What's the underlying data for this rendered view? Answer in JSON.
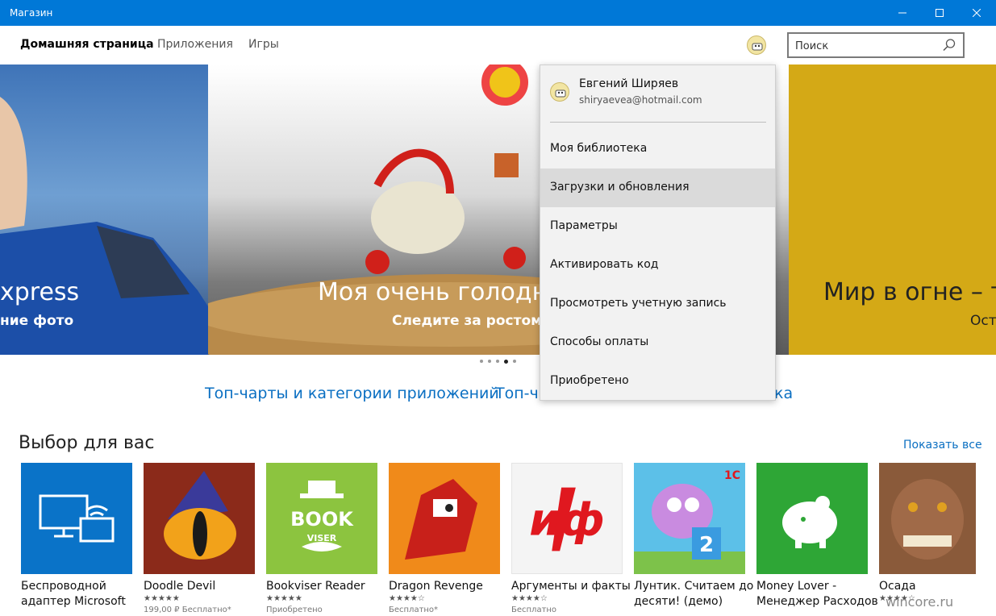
{
  "window": {
    "title": "Магазин",
    "controls": [
      "minimize-icon",
      "maximize-icon",
      "close-icon"
    ]
  },
  "nav": {
    "tabs": [
      "Домашняя страница",
      "Приложения",
      "Игры"
    ],
    "active_tab": "Домашняя страница",
    "search_placeholder": "Поиск"
  },
  "hero": {
    "slides": [
      {
        "title": "xpress",
        "subtitle": "ние фото"
      },
      {
        "title": "Моя очень голодна",
        "subtitle": "Следите за ростом п"
      },
      {
        "title": "Мир в огне – т",
        "subtitle": "Ост"
      }
    ],
    "dots_count": 5,
    "active_dot": 4
  },
  "links": [
    "Топ-чарты и категории приложений",
    "Топ-ч",
    "ка"
  ],
  "section": {
    "title": "Выбор для вас",
    "show_all": "Показать все"
  },
  "apps": [
    {
      "name1": "Беспроводной",
      "name2": "адаптер Microsoft",
      "stars": "",
      "price": "",
      "color": "#0a73c8"
    },
    {
      "name1": "Doodle Devil",
      "name2": "",
      "stars": "★★★★★",
      "price": "199,00 ₽ Бесплатно*",
      "color": "#8b2a1a"
    },
    {
      "name1": "Bookviser Reader",
      "name2": "",
      "stars": "★★★★★",
      "price": "Приобретено",
      "color": "#8cc43f"
    },
    {
      "name1": "Dragon Revenge",
      "name2": "",
      "stars": "★★★★☆",
      "price": "Бесплатно*",
      "color": "#e0541a"
    },
    {
      "name1": "Аргументы и факты",
      "name2": "",
      "stars": "★★★★☆",
      "price": "Бесплатно",
      "color": "#f4f4f4"
    },
    {
      "name1": "Лунтик. Считаем до",
      "name2": "десяти! (демо)",
      "stars": "",
      "price": "",
      "color": "#5cc0e8"
    },
    {
      "name1": "Money Lover -",
      "name2": "Менеджер Расходов",
      "stars": "",
      "price": "",
      "color": "#2ea636"
    },
    {
      "name1": "Осада",
      "name2": "",
      "stars": "★★★★☆",
      "price": "",
      "color": "#6b4a3a"
    }
  ],
  "account_menu": {
    "user_name": "Евгений Ширяев",
    "email": "shiryaevea@hotmail.com",
    "items": [
      "Моя библиотека",
      "Загрузки и обновления",
      "Параметры",
      "Активировать код",
      "Просмотреть учетную запись",
      "Способы оплаты",
      "Приобретено"
    ],
    "highlighted": "Загрузки и обновления"
  },
  "watermark": "wincore.ru",
  "colors": {
    "accent": "#0078d7",
    "link": "#0a6fc2",
    "menu_bg": "#f2f2f2"
  }
}
